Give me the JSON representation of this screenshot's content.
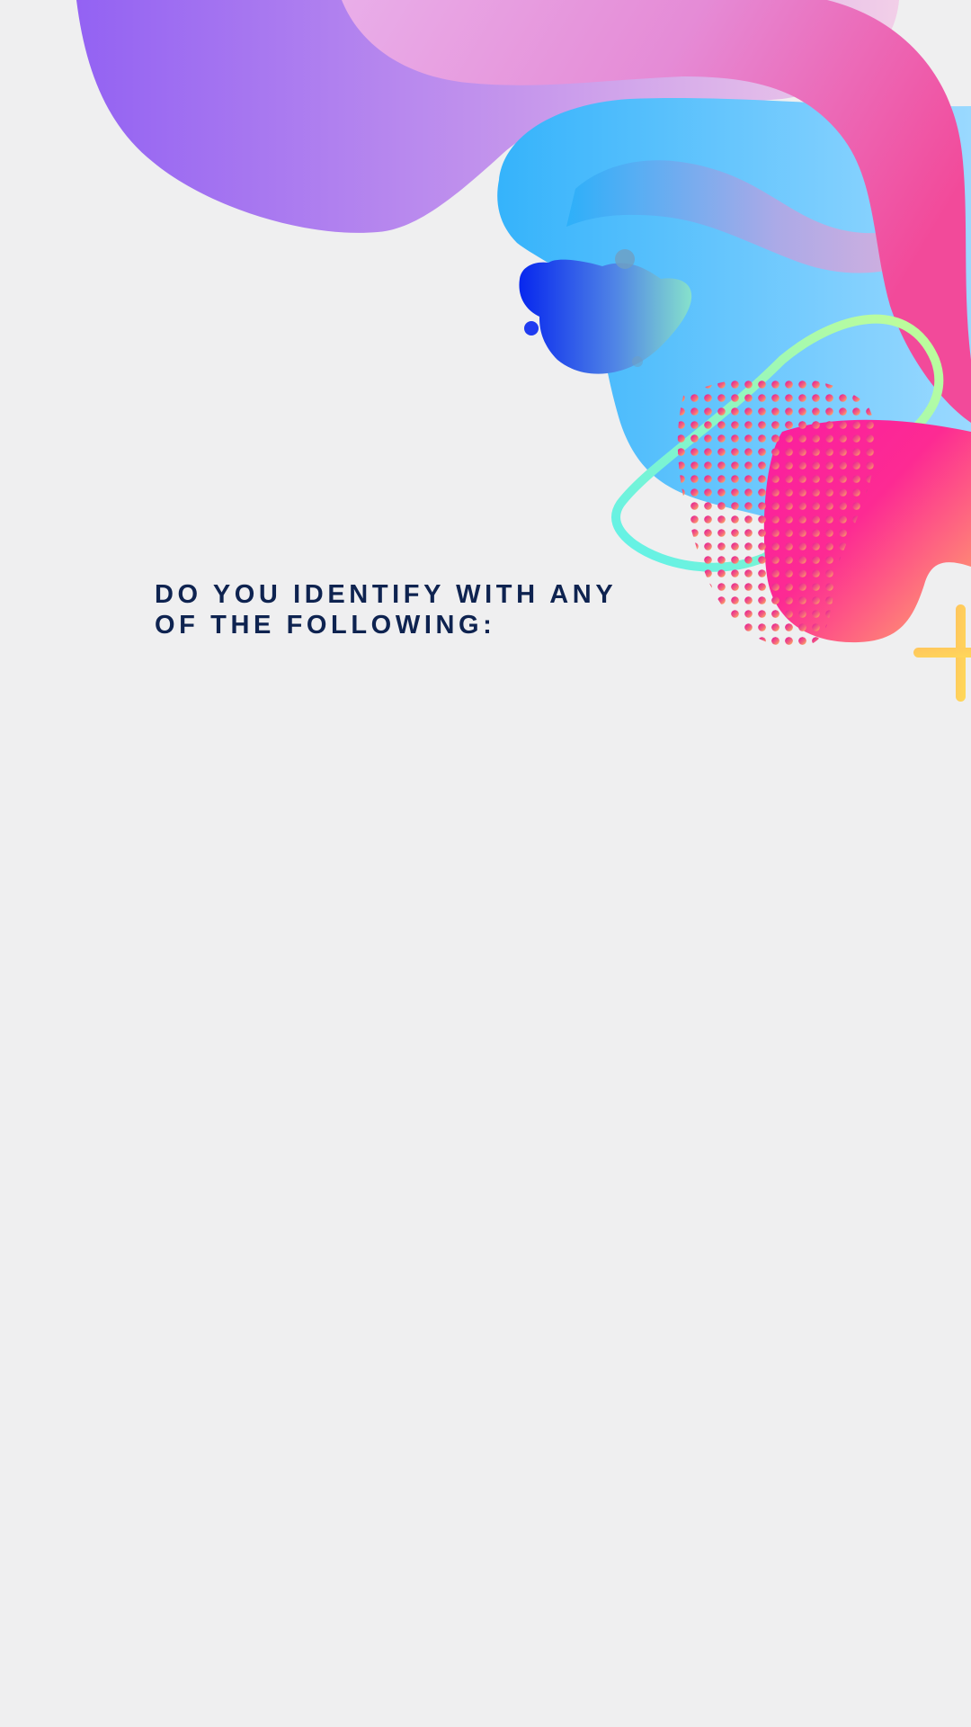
{
  "question": {
    "text": "DO YOU IDENTIFY WITH ANY OF THE FOLLOWING:"
  },
  "decoration": {
    "text_color": "#0e2350",
    "background_color": "#efeff0",
    "shapes": [
      "purple-gradient-wave",
      "pink-ribbon",
      "light-blue-blob",
      "blue-gradient-blob",
      "mint-outline-loop",
      "magenta-halftone-dot-blob",
      "pink-orange-gradient-blob",
      "yellow-plus-sign"
    ]
  },
  "options": []
}
